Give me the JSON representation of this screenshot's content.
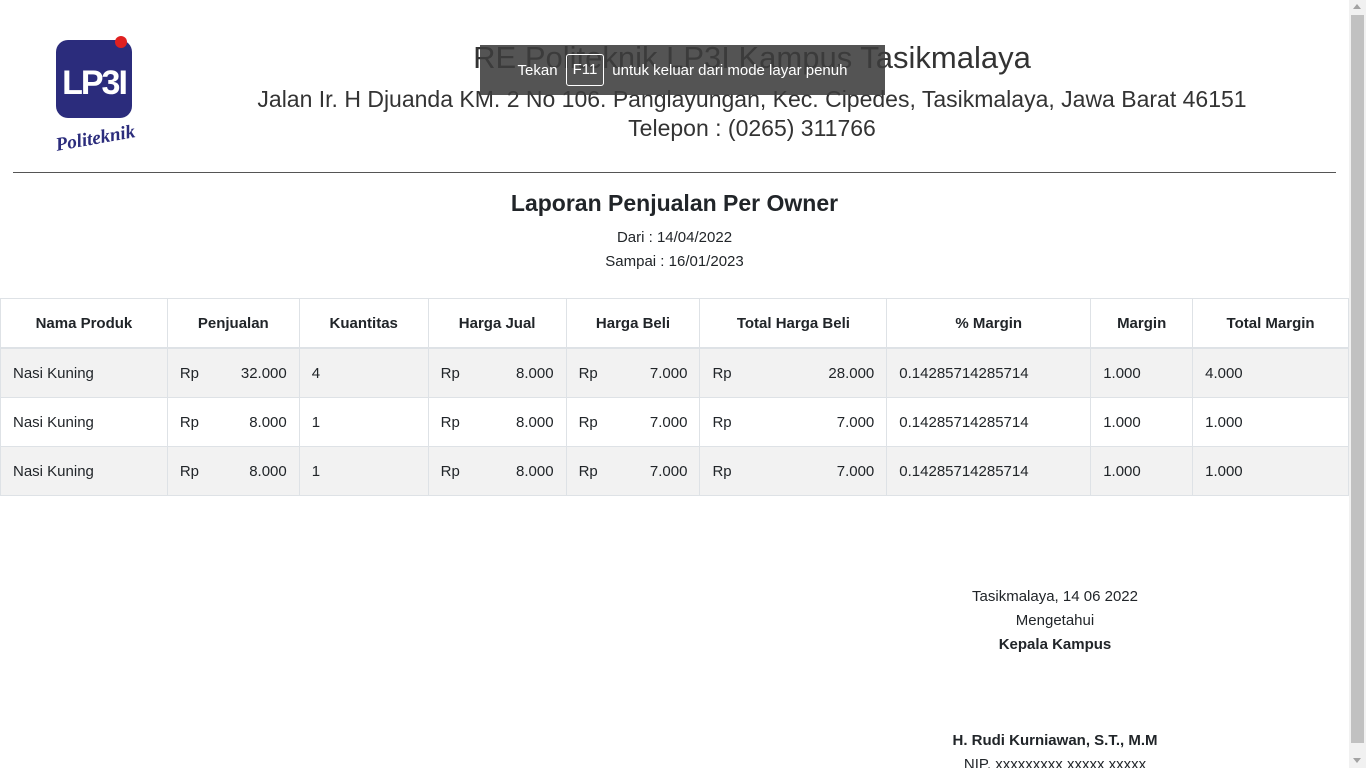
{
  "header": {
    "logo": {
      "icon": "lp3i-politeknik-logo",
      "text": "LP3I",
      "subtext": "Politeknik",
      "primary_color": "#2b2c7c",
      "accent_color": "#e02020"
    },
    "institution_name": "RE Politeknik LP3I Kampus Tasikmalaya",
    "address": "Jalan Ir. H Djuanda KM. 2 No 106. Panglayungan, Kec. Cipedes, Tasikmalaya, Jawa Barat 46151",
    "phone": "Telepon : (0265) 311766"
  },
  "report": {
    "title": "Laporan Penjualan Per Owner",
    "from": "Dari : 14/04/2022",
    "to": "Sampai : 16/01/2023"
  },
  "table": {
    "headers": [
      "Nama Produk",
      "Penjualan",
      "Kuantitas",
      "Harga Jual",
      "Harga Beli",
      "Total Harga Beli",
      "% Margin",
      "Margin",
      "Total Margin"
    ],
    "currency": "Rp",
    "rows": [
      {
        "nama": "Nasi Kuning",
        "penjualan": "32.000",
        "kuantitas": "4",
        "harga_jual": "8.000",
        "harga_beli": "7.000",
        "total_harga_beli": "28.000",
        "persen_margin": "0.14285714285714",
        "margin": "1.000",
        "total_margin": "4.000"
      },
      {
        "nama": "Nasi Kuning",
        "penjualan": "8.000",
        "kuantitas": "1",
        "harga_jual": "8.000",
        "harga_beli": "7.000",
        "total_harga_beli": "7.000",
        "persen_margin": "0.14285714285714",
        "margin": "1.000",
        "total_margin": "1.000"
      },
      {
        "nama": "Nasi Kuning",
        "penjualan": "8.000",
        "kuantitas": "1",
        "harga_jual": "8.000",
        "harga_beli": "7.000",
        "total_harga_beli": "7.000",
        "persen_margin": "0.14285714285714",
        "margin": "1.000",
        "total_margin": "1.000"
      }
    ]
  },
  "signature": {
    "place_date": "Tasikmalaya, 14 06 2022",
    "acknowledged": "Mengetahui",
    "role": "Kepala Kampus",
    "name": "H. Rudi Kurniawan, S.T., M.M",
    "nip": "NIP. xxxxxxxxx xxxxx xxxxx"
  },
  "fullscreen_notice": {
    "prefix": "Tekan",
    "key": "F11",
    "suffix": "untuk keluar dari mode layar penuh"
  }
}
